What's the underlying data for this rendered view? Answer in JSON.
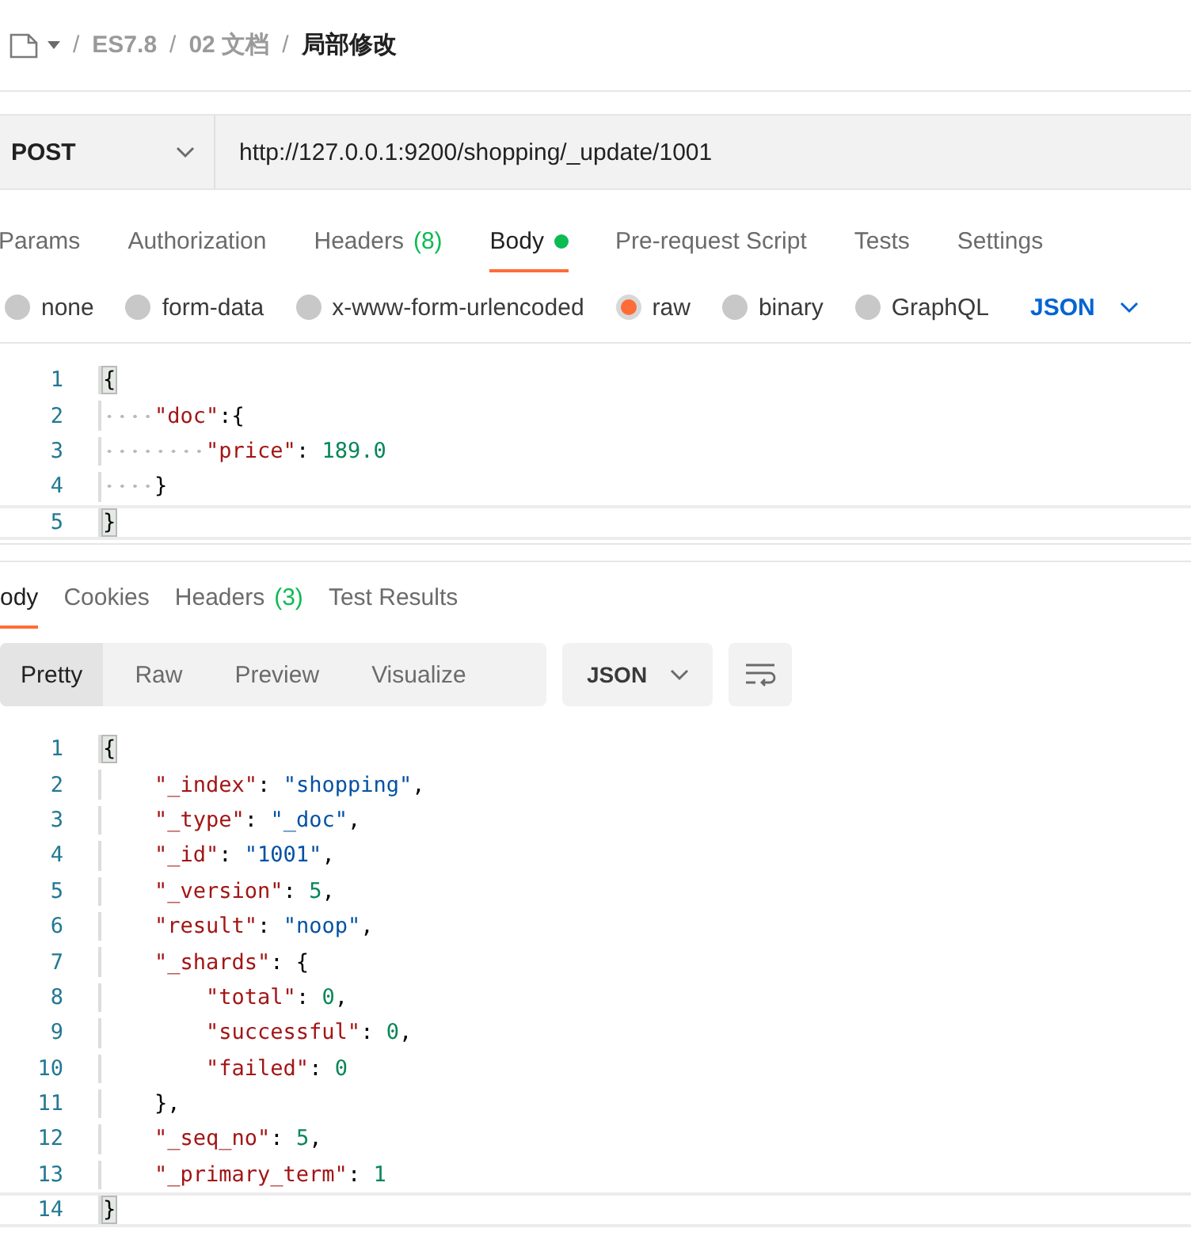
{
  "breadcrumb": [
    {
      "separator": "/",
      "text": "ES7.8"
    },
    {
      "separator": "/",
      "text": "02 文档"
    },
    {
      "separator": "/",
      "text": "局部修改"
    }
  ],
  "request": {
    "method": "POST",
    "url": "http://127.0.0.1:9200/shopping/_update/1001"
  },
  "request_tabs": [
    {
      "label": "Params",
      "selected": false,
      "dot": false
    },
    {
      "label": "Authorization",
      "selected": false,
      "dot": false
    },
    {
      "label": "Headers",
      "count": "(8)",
      "selected": false,
      "dot": false
    },
    {
      "label": "Body",
      "selected": true,
      "dot": true
    },
    {
      "label": "Pre-request Script",
      "selected": false,
      "dot": false
    },
    {
      "label": "Tests",
      "selected": false,
      "dot": false
    },
    {
      "label": "Settings",
      "selected": false,
      "dot": false
    }
  ],
  "body_types": [
    {
      "label": "none",
      "selected": false
    },
    {
      "label": "form-data",
      "selected": false
    },
    {
      "label": "x-www-form-urlencoded",
      "selected": false
    },
    {
      "label": "raw",
      "selected": true
    },
    {
      "label": "binary",
      "selected": false
    },
    {
      "label": "GraphQL",
      "selected": false
    }
  ],
  "body_format": "JSON",
  "request_body": {
    "show_whitespace": true,
    "lines": [
      {
        "number": "1",
        "active": false,
        "tokens": [
          {
            "kind": "match",
            "text": "{"
          }
        ]
      },
      {
        "number": "2",
        "active": false,
        "tokens": [
          {
            "kind": "key",
            "text": "    \"doc\""
          },
          {
            "kind": "punct",
            "text": ":{"
          }
        ]
      },
      {
        "number": "3",
        "active": false,
        "tokens": [
          {
            "kind": "key",
            "text": "        \"price\""
          },
          {
            "kind": "punct",
            "text": ": "
          },
          {
            "kind": "number",
            "text": "189.0"
          }
        ]
      },
      {
        "number": "4",
        "active": false,
        "tokens": [
          {
            "kind": "punct",
            "text": "    }"
          }
        ]
      },
      {
        "number": "5",
        "active": true,
        "tokens": [
          {
            "kind": "match",
            "text": "}"
          }
        ]
      }
    ]
  },
  "response_tabs": [
    {
      "label": "ody",
      "selected": true
    },
    {
      "label": "Cookies",
      "selected": false
    },
    {
      "label": "Headers",
      "count": "(3)",
      "selected": false
    },
    {
      "label": "Test Results",
      "selected": false
    }
  ],
  "view_modes": [
    {
      "label": "Pretty",
      "selected": true
    },
    {
      "label": "Raw",
      "selected": false
    },
    {
      "label": "Preview",
      "selected": false
    },
    {
      "label": "Visualize",
      "selected": false
    }
  ],
  "response_format": "JSON",
  "response_body": {
    "show_whitespace": false,
    "lines": [
      {
        "number": "1",
        "active": false,
        "tokens": [
          {
            "kind": "match",
            "text": "{"
          }
        ]
      },
      {
        "number": "2",
        "active": false,
        "tokens": [
          {
            "kind": "key",
            "text": "    \"_index\""
          },
          {
            "kind": "punct",
            "text": ": "
          },
          {
            "kind": "string",
            "text": "\"shopping\""
          },
          {
            "kind": "punct",
            "text": ","
          }
        ]
      },
      {
        "number": "3",
        "active": false,
        "tokens": [
          {
            "kind": "key",
            "text": "    \"_type\""
          },
          {
            "kind": "punct",
            "text": ": "
          },
          {
            "kind": "string",
            "text": "\"_doc\""
          },
          {
            "kind": "punct",
            "text": ","
          }
        ]
      },
      {
        "number": "4",
        "active": false,
        "tokens": [
          {
            "kind": "key",
            "text": "    \"_id\""
          },
          {
            "kind": "punct",
            "text": ": "
          },
          {
            "kind": "string",
            "text": "\"1001\""
          },
          {
            "kind": "punct",
            "text": ","
          }
        ]
      },
      {
        "number": "5",
        "active": false,
        "tokens": [
          {
            "kind": "key",
            "text": "    \"_version\""
          },
          {
            "kind": "punct",
            "text": ": "
          },
          {
            "kind": "number",
            "text": "5"
          },
          {
            "kind": "punct",
            "text": ","
          }
        ]
      },
      {
        "number": "6",
        "active": false,
        "tokens": [
          {
            "kind": "key",
            "text": "    \"result\""
          },
          {
            "kind": "punct",
            "text": ": "
          },
          {
            "kind": "string",
            "text": "\"noop\""
          },
          {
            "kind": "punct",
            "text": ","
          }
        ]
      },
      {
        "number": "7",
        "active": false,
        "tokens": [
          {
            "kind": "key",
            "text": "    \"_shards\""
          },
          {
            "kind": "punct",
            "text": ": {"
          }
        ]
      },
      {
        "number": "8",
        "active": false,
        "tokens": [
          {
            "kind": "key",
            "text": "        \"total\""
          },
          {
            "kind": "punct",
            "text": ": "
          },
          {
            "kind": "number",
            "text": "0"
          },
          {
            "kind": "punct",
            "text": ","
          }
        ]
      },
      {
        "number": "9",
        "active": false,
        "tokens": [
          {
            "kind": "key",
            "text": "        \"successful\""
          },
          {
            "kind": "punct",
            "text": ": "
          },
          {
            "kind": "number",
            "text": "0"
          },
          {
            "kind": "punct",
            "text": ","
          }
        ]
      },
      {
        "number": "10",
        "active": false,
        "tokens": [
          {
            "kind": "key",
            "text": "        \"failed\""
          },
          {
            "kind": "punct",
            "text": ": "
          },
          {
            "kind": "number",
            "text": "0"
          }
        ]
      },
      {
        "number": "11",
        "active": false,
        "tokens": [
          {
            "kind": "punct",
            "text": "    },"
          }
        ]
      },
      {
        "number": "12",
        "active": false,
        "tokens": [
          {
            "kind": "key",
            "text": "    \"_seq_no\""
          },
          {
            "kind": "punct",
            "text": ": "
          },
          {
            "kind": "number",
            "text": "5"
          },
          {
            "kind": "punct",
            "text": ","
          }
        ]
      },
      {
        "number": "13",
        "active": false,
        "tokens": [
          {
            "kind": "key",
            "text": "    \"_primary_term\""
          },
          {
            "kind": "punct",
            "text": ": "
          },
          {
            "kind": "number",
            "text": "1"
          }
        ]
      },
      {
        "number": "14",
        "active": true,
        "tokens": [
          {
            "kind": "match",
            "text": "}"
          }
        ]
      }
    ]
  }
}
